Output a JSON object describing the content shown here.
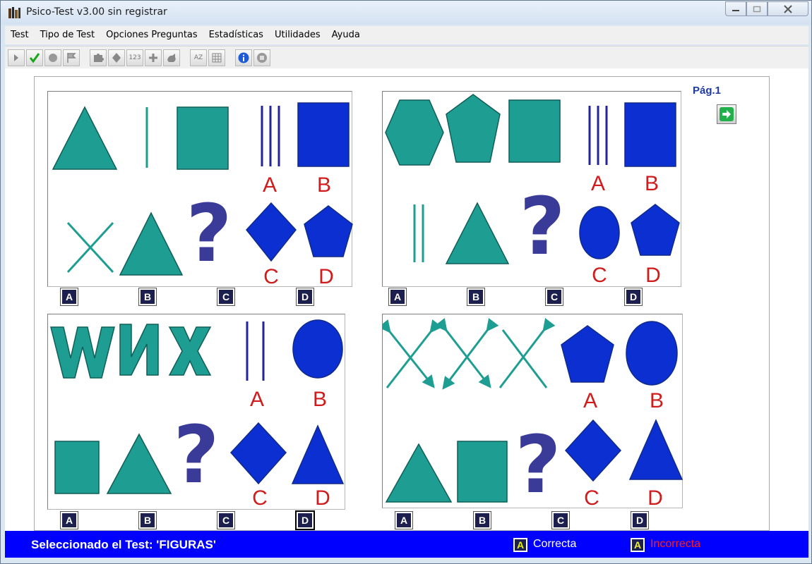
{
  "window": {
    "title": "Psico-Test v3.00 sin registrar",
    "controls": {
      "minimize": "minimize-icon",
      "maximize": "maximize-icon",
      "close": "close-icon"
    }
  },
  "menu": [
    "Test",
    "Tipo de Test",
    "Opciones Preguntas",
    "Estadísticas",
    "Utilidades",
    "Ayuda"
  ],
  "toolbar": {
    "buttons": [
      "play-icon",
      "check-icon",
      "circle-icon",
      "flag-icon",
      "puzzle-icon",
      "diamond-icon",
      "numbers-icon",
      "plus-icon",
      "animal-icon",
      "sort-icon",
      "grid-icon",
      "info-icon",
      "stop-icon"
    ],
    "numbers_icon_text": "123",
    "sort_icon_text": "AZ"
  },
  "page": {
    "label": "Pág.1",
    "next": "arrow-right-icon"
  },
  "questions": [
    {
      "id": 1,
      "choice_labels": [
        "A",
        "B",
        "C",
        "D"
      ],
      "options": [
        "A",
        "B",
        "C",
        "D"
      ],
      "selected": null
    },
    {
      "id": 2,
      "choice_labels": [
        "A",
        "B",
        "C",
        "D"
      ],
      "options": [
        "A",
        "B",
        "C",
        "D"
      ],
      "selected": null
    },
    {
      "id": 3,
      "choice_labels": [
        "A",
        "B",
        "C",
        "D"
      ],
      "options": [
        "A",
        "B",
        "C",
        "D"
      ],
      "selected": "D"
    },
    {
      "id": 4,
      "choice_labels": [
        "A",
        "B",
        "C",
        "D"
      ],
      "options": [
        "A",
        "B",
        "C",
        "D"
      ],
      "selected": null
    }
  ],
  "status": {
    "text": "Seleccionado el Test: 'FIGURAS'",
    "legend_correct_box": "A",
    "legend_correct": "Correcta",
    "legend_incorrect_box": "A",
    "legend_incorrect": "Incorrecta"
  },
  "colors": {
    "teal": "#1e9e92",
    "blue": "#0b2fd1",
    "question": "#3a3a99",
    "label_red": "#d01c1c",
    "status_bar": "#0000ff"
  }
}
